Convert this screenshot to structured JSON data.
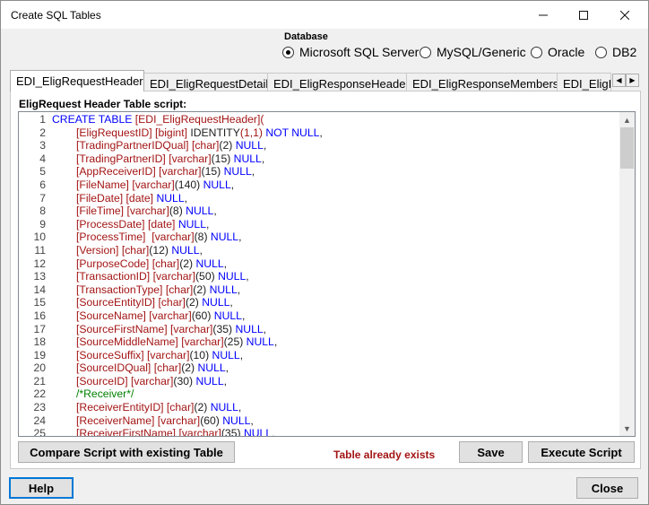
{
  "window": {
    "title": "Create SQL Tables"
  },
  "database": {
    "label": "Database",
    "options": [
      {
        "label": "Microsoft SQL Server",
        "checked": true
      },
      {
        "label": "MySQL/Generic",
        "checked": false
      },
      {
        "label": "Oracle",
        "checked": false
      },
      {
        "label": "DB2",
        "checked": false
      }
    ]
  },
  "tabs": [
    {
      "label": "EDI_EligRequestHeader",
      "active": true
    },
    {
      "label": "EDI_EligRequestDetail",
      "active": false
    },
    {
      "label": "EDI_EligResponseHeader",
      "active": false
    },
    {
      "label": "EDI_EligResponseMembers",
      "active": false
    },
    {
      "label": "EDI_EligI",
      "active": false
    }
  ],
  "panel": {
    "script_label": "EligRequest Header Table script:",
    "status": "Table already exists",
    "compare_button": "Compare Script with existing Table",
    "save_button": "Save",
    "execute_button": "Execute Script"
  },
  "code_lines": [
    {
      "n": "1",
      "indent": false,
      "segs": [
        [
          "k",
          "CREATE TABLE "
        ],
        [
          "i",
          "[EDI_EligRequestHeader]"
        ],
        [
          "i",
          "("
        ]
      ]
    },
    {
      "n": "2",
      "indent": true,
      "segs": [
        [
          "i",
          "[EligRequestID] [bigint] "
        ],
        [
          "t",
          "IDENTITY"
        ],
        [
          "i",
          "(1,1) "
        ],
        [
          "k",
          "NOT NULL"
        ],
        [
          "t",
          ","
        ]
      ]
    },
    {
      "n": "3",
      "indent": true,
      "segs": [
        [
          "i",
          "[TradingPartnerIDQual] "
        ],
        [
          "i",
          "[char]"
        ],
        [
          "t",
          "(2) "
        ],
        [
          "k",
          "NULL"
        ],
        [
          "t",
          ","
        ]
      ]
    },
    {
      "n": "4",
      "indent": true,
      "segs": [
        [
          "i",
          "[TradingPartnerID] "
        ],
        [
          "i",
          "[varchar]"
        ],
        [
          "t",
          "(15) "
        ],
        [
          "k",
          "NULL"
        ],
        [
          "t",
          ","
        ]
      ]
    },
    {
      "n": "5",
      "indent": true,
      "segs": [
        [
          "i",
          "[AppReceiverID] "
        ],
        [
          "i",
          "[varchar]"
        ],
        [
          "t",
          "(15) "
        ],
        [
          "k",
          "NULL"
        ],
        [
          "t",
          ","
        ]
      ]
    },
    {
      "n": "6",
      "indent": true,
      "segs": [
        [
          "i",
          "[FileName] "
        ],
        [
          "i",
          "[varchar]"
        ],
        [
          "t",
          "(140) "
        ],
        [
          "k",
          "NULL"
        ],
        [
          "t",
          ","
        ]
      ]
    },
    {
      "n": "7",
      "indent": true,
      "segs": [
        [
          "i",
          "[FileDate] "
        ],
        [
          "i",
          "[date] "
        ],
        [
          "k",
          "NULL"
        ],
        [
          "t",
          ","
        ]
      ]
    },
    {
      "n": "8",
      "indent": true,
      "segs": [
        [
          "i",
          "[FileTime] "
        ],
        [
          "i",
          "[varchar]"
        ],
        [
          "t",
          "(8) "
        ],
        [
          "k",
          "NULL"
        ],
        [
          "t",
          ","
        ]
      ]
    },
    {
      "n": "9",
      "indent": true,
      "segs": [
        [
          "i",
          "[ProcessDate] "
        ],
        [
          "i",
          "[date] "
        ],
        [
          "k",
          "NULL"
        ],
        [
          "t",
          ","
        ]
      ]
    },
    {
      "n": "10",
      "indent": true,
      "segs": [
        [
          "i",
          "[ProcessTime]  "
        ],
        [
          "i",
          "[varchar]"
        ],
        [
          "t",
          "(8) "
        ],
        [
          "k",
          "NULL"
        ],
        [
          "t",
          ","
        ]
      ]
    },
    {
      "n": "11",
      "indent": true,
      "segs": [
        [
          "i",
          "[Version] "
        ],
        [
          "i",
          "[char]"
        ],
        [
          "t",
          "(12) "
        ],
        [
          "k",
          "NULL"
        ],
        [
          "t",
          ","
        ]
      ]
    },
    {
      "n": "12",
      "indent": true,
      "segs": [
        [
          "i",
          "[PurposeCode] "
        ],
        [
          "i",
          "[char]"
        ],
        [
          "t",
          "(2) "
        ],
        [
          "k",
          "NULL"
        ],
        [
          "t",
          ","
        ]
      ]
    },
    {
      "n": "13",
      "indent": true,
      "segs": [
        [
          "i",
          "[TransactionID] "
        ],
        [
          "i",
          "[varchar]"
        ],
        [
          "t",
          "(50) "
        ],
        [
          "k",
          "NULL"
        ],
        [
          "t",
          ","
        ]
      ]
    },
    {
      "n": "14",
      "indent": true,
      "segs": [
        [
          "i",
          "[TransactionType] "
        ],
        [
          "i",
          "[char]"
        ],
        [
          "t",
          "(2) "
        ],
        [
          "k",
          "NULL"
        ],
        [
          "t",
          ","
        ]
      ]
    },
    {
      "n": "15",
      "indent": true,
      "segs": [
        [
          "i",
          "[SourceEntityID] "
        ],
        [
          "i",
          "[char]"
        ],
        [
          "t",
          "(2) "
        ],
        [
          "k",
          "NULL"
        ],
        [
          "t",
          ","
        ]
      ]
    },
    {
      "n": "16",
      "indent": true,
      "segs": [
        [
          "i",
          "[SourceName] "
        ],
        [
          "i",
          "[varchar]"
        ],
        [
          "t",
          "(60) "
        ],
        [
          "k",
          "NULL"
        ],
        [
          "t",
          ","
        ]
      ]
    },
    {
      "n": "17",
      "indent": true,
      "segs": [
        [
          "i",
          "[SourceFirstName] "
        ],
        [
          "i",
          "[varchar]"
        ],
        [
          "t",
          "(35) "
        ],
        [
          "k",
          "NULL"
        ],
        [
          "t",
          ","
        ]
      ]
    },
    {
      "n": "18",
      "indent": true,
      "segs": [
        [
          "i",
          "[SourceMiddleName] "
        ],
        [
          "i",
          "[varchar]"
        ],
        [
          "t",
          "(25) "
        ],
        [
          "k",
          "NULL"
        ],
        [
          "t",
          ","
        ]
      ]
    },
    {
      "n": "19",
      "indent": true,
      "segs": [
        [
          "i",
          "[SourceSuffix] "
        ],
        [
          "i",
          "[varchar]"
        ],
        [
          "t",
          "(10) "
        ],
        [
          "k",
          "NULL"
        ],
        [
          "t",
          ","
        ]
      ]
    },
    {
      "n": "20",
      "indent": true,
      "segs": [
        [
          "i",
          "[SourceIDQual] "
        ],
        [
          "i",
          "[char]"
        ],
        [
          "t",
          "(2) "
        ],
        [
          "k",
          "NULL"
        ],
        [
          "t",
          ","
        ]
      ]
    },
    {
      "n": "21",
      "indent": true,
      "segs": [
        [
          "i",
          "[SourceID] "
        ],
        [
          "i",
          "[varchar]"
        ],
        [
          "t",
          "(30) "
        ],
        [
          "k",
          "NULL"
        ],
        [
          "t",
          ","
        ]
      ]
    },
    {
      "n": "22",
      "indent": true,
      "segs": [
        [
          "c",
          "/*Receiver*/"
        ]
      ]
    },
    {
      "n": "23",
      "indent": true,
      "segs": [
        [
          "i",
          "[ReceiverEntityID] "
        ],
        [
          "i",
          "[char]"
        ],
        [
          "t",
          "(2) "
        ],
        [
          "k",
          "NULL"
        ],
        [
          "t",
          ","
        ]
      ]
    },
    {
      "n": "24",
      "indent": true,
      "segs": [
        [
          "i",
          "[ReceiverName] "
        ],
        [
          "i",
          "[varchar]"
        ],
        [
          "t",
          "(60) "
        ],
        [
          "k",
          "NULL"
        ],
        [
          "t",
          ","
        ]
      ]
    },
    {
      "n": "25",
      "indent": true,
      "segs": [
        [
          "i",
          "[ReceiverFirstName] "
        ],
        [
          "i",
          "[varchar]"
        ],
        [
          "t",
          "(35) "
        ],
        [
          "k",
          "NULL"
        ],
        [
          "t",
          ","
        ]
      ]
    }
  ],
  "footer": {
    "help_button": "Help",
    "close_button": "Close"
  }
}
